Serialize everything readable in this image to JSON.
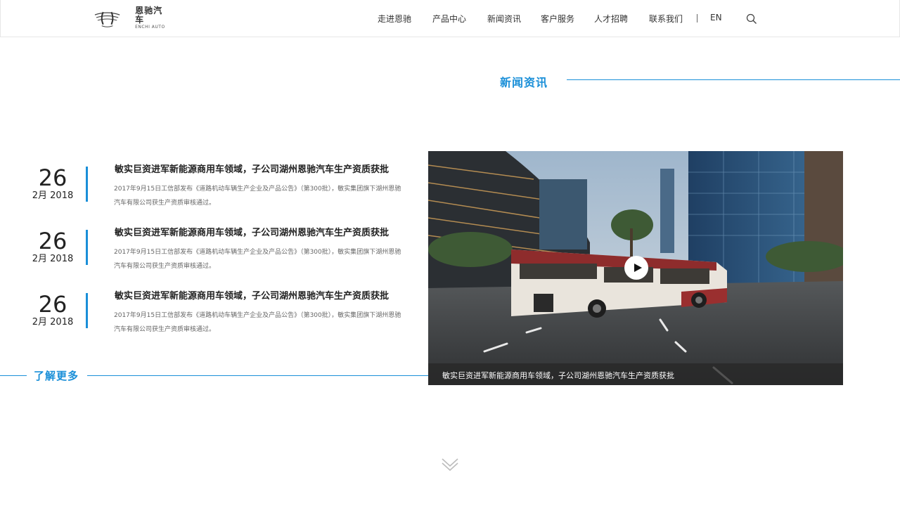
{
  "header": {
    "logo_cn": "恩驰汽车",
    "logo_en": "ENCHI AUTO",
    "nav": [
      {
        "label": "走进恩驰"
      },
      {
        "label": "产品中心"
      },
      {
        "label": "新闻资讯"
      },
      {
        "label": "客户服务"
      },
      {
        "label": "人才招聘"
      },
      {
        "label": "联系我们"
      }
    ],
    "lang": "EN",
    "search_icon": "search-icon"
  },
  "section": {
    "title": "新闻资讯"
  },
  "news": [
    {
      "day": "26",
      "month": "2月 2018",
      "title": "敏实巨资进军新能源商用车领域，子公司湖州恩驰汽车生产资质获批",
      "desc": "2017年9月15日工信部发布《道路机动车辆生产企业及产品公告》（第300批），敏实集团旗下湖州恩驰汽车有限公司获生产资质审核通过。"
    },
    {
      "day": "26",
      "month": "2月 2018",
      "title": "敏实巨资进军新能源商用车领域，子公司湖州恩驰汽车生产资质获批",
      "desc": "2017年9月15日工信部发布《道路机动车辆生产企业及产品公告》（第300批），敏实集团旗下湖州恩驰汽车有限公司获生产资质审核通过。"
    },
    {
      "day": "26",
      "month": "2月 2018",
      "title": "敏实巨资进军新能源商用车领域，子公司湖州恩驰汽车生产资质获批",
      "desc": "2017年9月15日工信部发布《道路机动车辆生产企业及产品公告》（第300批），敏实集团旗下湖州恩驰汽车有限公司获生产资质审核通过。"
    }
  ],
  "more": {
    "label": "了解更多"
  },
  "video": {
    "caption": "敏实巨资进军新能源商用车领域，子公司湖州恩驰汽车生产资质获批",
    "play_icon": "play-icon"
  },
  "colors": {
    "accent": "#1a8fd8"
  }
}
